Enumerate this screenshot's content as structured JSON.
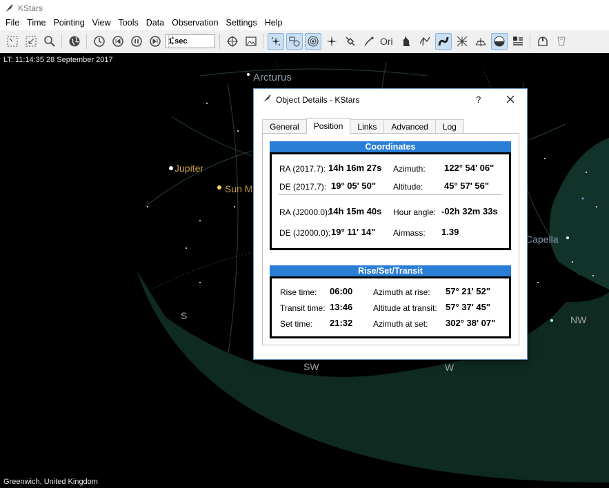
{
  "window": {
    "title": "KStars"
  },
  "menu": [
    "File",
    "Time",
    "Pointing",
    "View",
    "Tools",
    "Data",
    "Observation",
    "Settings",
    "Help"
  ],
  "toolbar": {
    "time_step": "1 sec"
  },
  "sky": {
    "status_time": "LT: 11:14:35   28 September 2017",
    "location": "Greenwich, United Kingdom",
    "labels": {
      "arcturus": "Arcturus",
      "jupiter": "Jupiter",
      "sun": "Sun M",
      "capella": "Capella",
      "s": "S",
      "sw": "SW",
      "w": "W",
      "nw": "NW"
    },
    "colors": {
      "ground": "#0f2a20",
      "planet_label": "#c8a04a",
      "star_label": "#8a9aa8",
      "compass": "#a8a8a8"
    }
  },
  "dialog": {
    "title": "Object Details - KStars",
    "help": "?",
    "tabs": [
      "General",
      "Position",
      "Links",
      "Advanced",
      "Log"
    ],
    "active_tab": "Position",
    "coordinates": {
      "heading": "Coordinates",
      "ra_epoch_label": "RA (2017.7):",
      "ra_epoch_value": "14h 16m 27s",
      "azimuth_label": "Azimuth:",
      "azimuth_value": "122° 54' 06\"",
      "de_epoch_label": "DE (2017.7):",
      "de_epoch_value": "19° 05' 50\"",
      "altitude_label": "Altitude:",
      "altitude_value": "45° 57' 56\"",
      "ra_j2000_label": "RA (J2000.0):",
      "ra_j2000_value": "14h 15m 40s",
      "hour_angle_label": "Hour angle:",
      "hour_angle_value": "-02h 32m 33s",
      "de_j2000_label": "DE (J2000.0):",
      "de_j2000_value": "19° 11' 14\"",
      "airmass_label": "Airmass:",
      "airmass_value": "1.39"
    },
    "rise_set": {
      "heading": "Rise/Set/Transit",
      "rise_time_label": "Rise time:",
      "rise_time_value": "06:00",
      "az_rise_label": "Azimuth at rise:",
      "az_rise_value": "57° 21' 52\"",
      "transit_time_label": "Transit time:",
      "transit_time_value": "13:46",
      "alt_transit_label": "Altitude at transit:",
      "alt_transit_value": "57° 37' 45\"",
      "set_time_label": "Set time:",
      "set_time_value": "21:32",
      "az_set_label": "Azimuth at set:",
      "az_set_value": "302° 38' 07\""
    }
  }
}
